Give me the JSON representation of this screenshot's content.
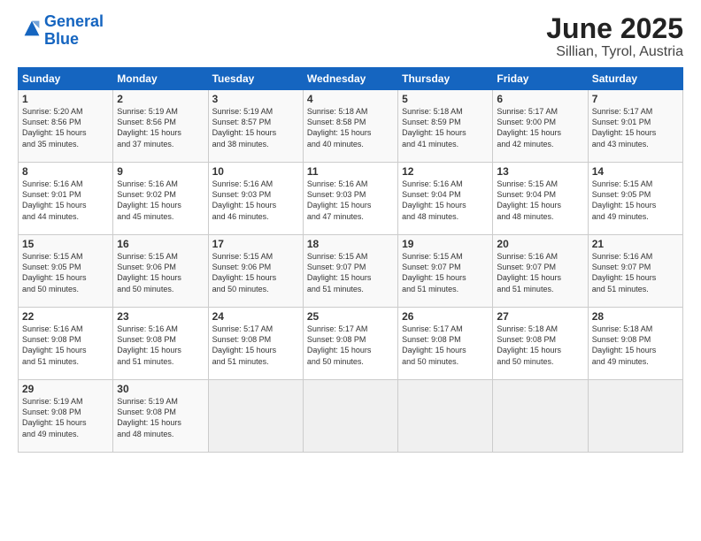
{
  "logo": {
    "text_general": "General",
    "text_blue": "Blue"
  },
  "title": "June 2025",
  "subtitle": "Sillian, Tyrol, Austria",
  "days_header": [
    "Sunday",
    "Monday",
    "Tuesday",
    "Wednesday",
    "Thursday",
    "Friday",
    "Saturday"
  ],
  "weeks": [
    [
      {
        "day": "1",
        "info": "Sunrise: 5:20 AM\nSunset: 8:56 PM\nDaylight: 15 hours\nand 35 minutes."
      },
      {
        "day": "2",
        "info": "Sunrise: 5:19 AM\nSunset: 8:56 PM\nDaylight: 15 hours\nand 37 minutes."
      },
      {
        "day": "3",
        "info": "Sunrise: 5:19 AM\nSunset: 8:57 PM\nDaylight: 15 hours\nand 38 minutes."
      },
      {
        "day": "4",
        "info": "Sunrise: 5:18 AM\nSunset: 8:58 PM\nDaylight: 15 hours\nand 40 minutes."
      },
      {
        "day": "5",
        "info": "Sunrise: 5:18 AM\nSunset: 8:59 PM\nDaylight: 15 hours\nand 41 minutes."
      },
      {
        "day": "6",
        "info": "Sunrise: 5:17 AM\nSunset: 9:00 PM\nDaylight: 15 hours\nand 42 minutes."
      },
      {
        "day": "7",
        "info": "Sunrise: 5:17 AM\nSunset: 9:01 PM\nDaylight: 15 hours\nand 43 minutes."
      }
    ],
    [
      {
        "day": "8",
        "info": "Sunrise: 5:16 AM\nSunset: 9:01 PM\nDaylight: 15 hours\nand 44 minutes."
      },
      {
        "day": "9",
        "info": "Sunrise: 5:16 AM\nSunset: 9:02 PM\nDaylight: 15 hours\nand 45 minutes."
      },
      {
        "day": "10",
        "info": "Sunrise: 5:16 AM\nSunset: 9:03 PM\nDaylight: 15 hours\nand 46 minutes."
      },
      {
        "day": "11",
        "info": "Sunrise: 5:16 AM\nSunset: 9:03 PM\nDaylight: 15 hours\nand 47 minutes."
      },
      {
        "day": "12",
        "info": "Sunrise: 5:16 AM\nSunset: 9:04 PM\nDaylight: 15 hours\nand 48 minutes."
      },
      {
        "day": "13",
        "info": "Sunrise: 5:15 AM\nSunset: 9:04 PM\nDaylight: 15 hours\nand 48 minutes."
      },
      {
        "day": "14",
        "info": "Sunrise: 5:15 AM\nSunset: 9:05 PM\nDaylight: 15 hours\nand 49 minutes."
      }
    ],
    [
      {
        "day": "15",
        "info": "Sunrise: 5:15 AM\nSunset: 9:05 PM\nDaylight: 15 hours\nand 50 minutes."
      },
      {
        "day": "16",
        "info": "Sunrise: 5:15 AM\nSunset: 9:06 PM\nDaylight: 15 hours\nand 50 minutes."
      },
      {
        "day": "17",
        "info": "Sunrise: 5:15 AM\nSunset: 9:06 PM\nDaylight: 15 hours\nand 50 minutes."
      },
      {
        "day": "18",
        "info": "Sunrise: 5:15 AM\nSunset: 9:07 PM\nDaylight: 15 hours\nand 51 minutes."
      },
      {
        "day": "19",
        "info": "Sunrise: 5:15 AM\nSunset: 9:07 PM\nDaylight: 15 hours\nand 51 minutes."
      },
      {
        "day": "20",
        "info": "Sunrise: 5:16 AM\nSunset: 9:07 PM\nDaylight: 15 hours\nand 51 minutes."
      },
      {
        "day": "21",
        "info": "Sunrise: 5:16 AM\nSunset: 9:07 PM\nDaylight: 15 hours\nand 51 minutes."
      }
    ],
    [
      {
        "day": "22",
        "info": "Sunrise: 5:16 AM\nSunset: 9:08 PM\nDaylight: 15 hours\nand 51 minutes."
      },
      {
        "day": "23",
        "info": "Sunrise: 5:16 AM\nSunset: 9:08 PM\nDaylight: 15 hours\nand 51 minutes."
      },
      {
        "day": "24",
        "info": "Sunrise: 5:17 AM\nSunset: 9:08 PM\nDaylight: 15 hours\nand 51 minutes."
      },
      {
        "day": "25",
        "info": "Sunrise: 5:17 AM\nSunset: 9:08 PM\nDaylight: 15 hours\nand 50 minutes."
      },
      {
        "day": "26",
        "info": "Sunrise: 5:17 AM\nSunset: 9:08 PM\nDaylight: 15 hours\nand 50 minutes."
      },
      {
        "day": "27",
        "info": "Sunrise: 5:18 AM\nSunset: 9:08 PM\nDaylight: 15 hours\nand 50 minutes."
      },
      {
        "day": "28",
        "info": "Sunrise: 5:18 AM\nSunset: 9:08 PM\nDaylight: 15 hours\nand 49 minutes."
      }
    ],
    [
      {
        "day": "29",
        "info": "Sunrise: 5:19 AM\nSunset: 9:08 PM\nDaylight: 15 hours\nand 49 minutes."
      },
      {
        "day": "30",
        "info": "Sunrise: 5:19 AM\nSunset: 9:08 PM\nDaylight: 15 hours\nand 48 minutes."
      },
      {
        "day": "",
        "info": ""
      },
      {
        "day": "",
        "info": ""
      },
      {
        "day": "",
        "info": ""
      },
      {
        "day": "",
        "info": ""
      },
      {
        "day": "",
        "info": ""
      }
    ]
  ]
}
